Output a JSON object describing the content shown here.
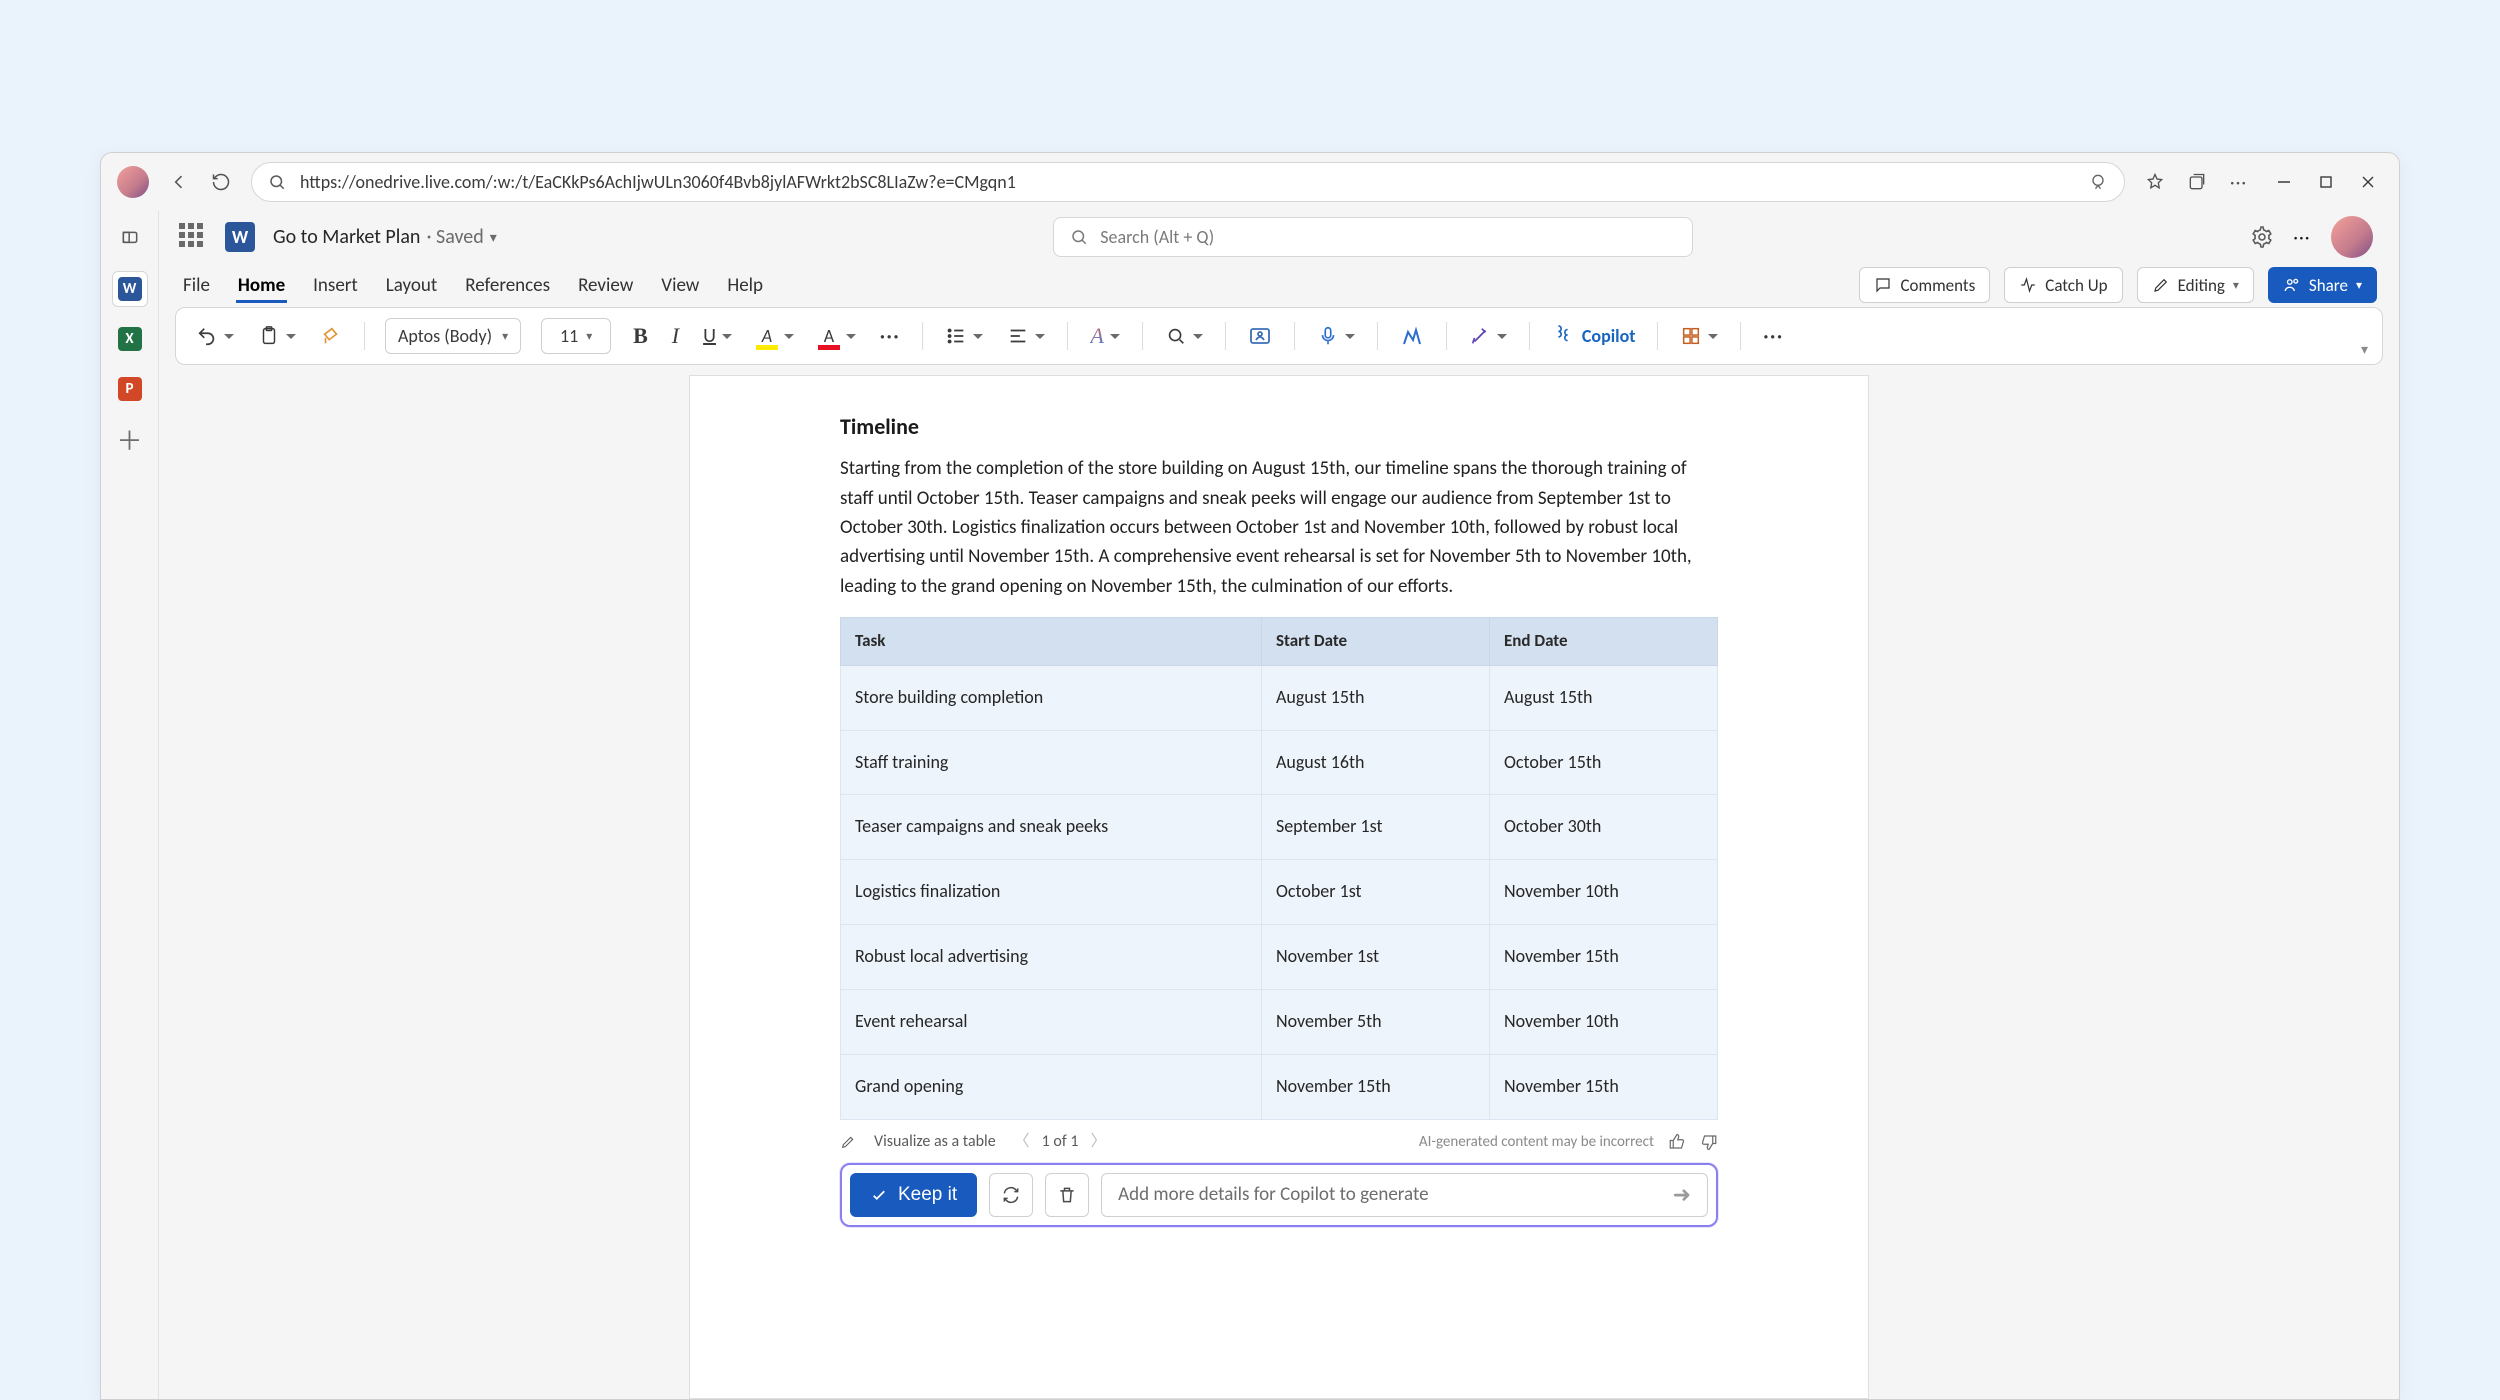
{
  "browser": {
    "url": "https://onedrive.live.com/:w:/t/EaCKkPs6AchIjwULn3060f4Bvb8jylAFWrkt2bSC8LIaZw?e=CMgqn1"
  },
  "titlebar": {
    "doc_name": "Go to Market Plan",
    "status": "· Saved",
    "search_placeholder": "Search (Alt + Q)"
  },
  "menu": {
    "items": [
      "File",
      "Home",
      "Insert",
      "Layout",
      "References",
      "Review",
      "View",
      "Help"
    ],
    "comments": "Comments",
    "catchup": "Catch Up",
    "editing": "Editing",
    "share": "Share"
  },
  "ribbon": {
    "font": "Aptos (Body)",
    "size": "11",
    "copilot": "Copilot"
  },
  "document": {
    "heading": "Timeline",
    "paragraph": "Starting from the completion of the store building on August 15th, our timeline spans the thorough training of staff until October 15th. Teaser campaigns and sneak peeks will engage our audience from September 1st to October 30th. Logistics finalization occurs between October 1st and November 10th, followed by robust local advertising until November 15th. A comprehensive event rehearsal is set for November 5th to November 10th, leading to the grand opening on November 15th, the culmination of our efforts.",
    "table": {
      "headers": [
        "Task",
        "Start Date",
        "End Date"
      ],
      "rows": [
        {
          "task": "Store building completion",
          "start": "August 15th",
          "end": "August 15th"
        },
        {
          "task": "Staff training",
          "start": "August 16th",
          "end": "October 15th"
        },
        {
          "task": "Teaser campaigns and sneak peeks",
          "start": "September 1st",
          "end": "October 30th"
        },
        {
          "task": "Logistics finalization",
          "start": "October 1st",
          "end": "November 10th"
        },
        {
          "task": "Robust local advertising",
          "start": "November 1st",
          "end": "November 15th"
        },
        {
          "task": "Event rehearsal",
          "start": "November 5th",
          "end": "November 10th"
        },
        {
          "task": "Grand opening",
          "start": "November 15th",
          "end": "November 15th"
        }
      ]
    }
  },
  "copilot": {
    "visualize": "Visualize as a table",
    "pager": "1 of 1",
    "ai_note": "AI-generated content may be incorrect",
    "keep": "Keep it",
    "input_placeholder": "Add more details for Copilot to generate"
  }
}
